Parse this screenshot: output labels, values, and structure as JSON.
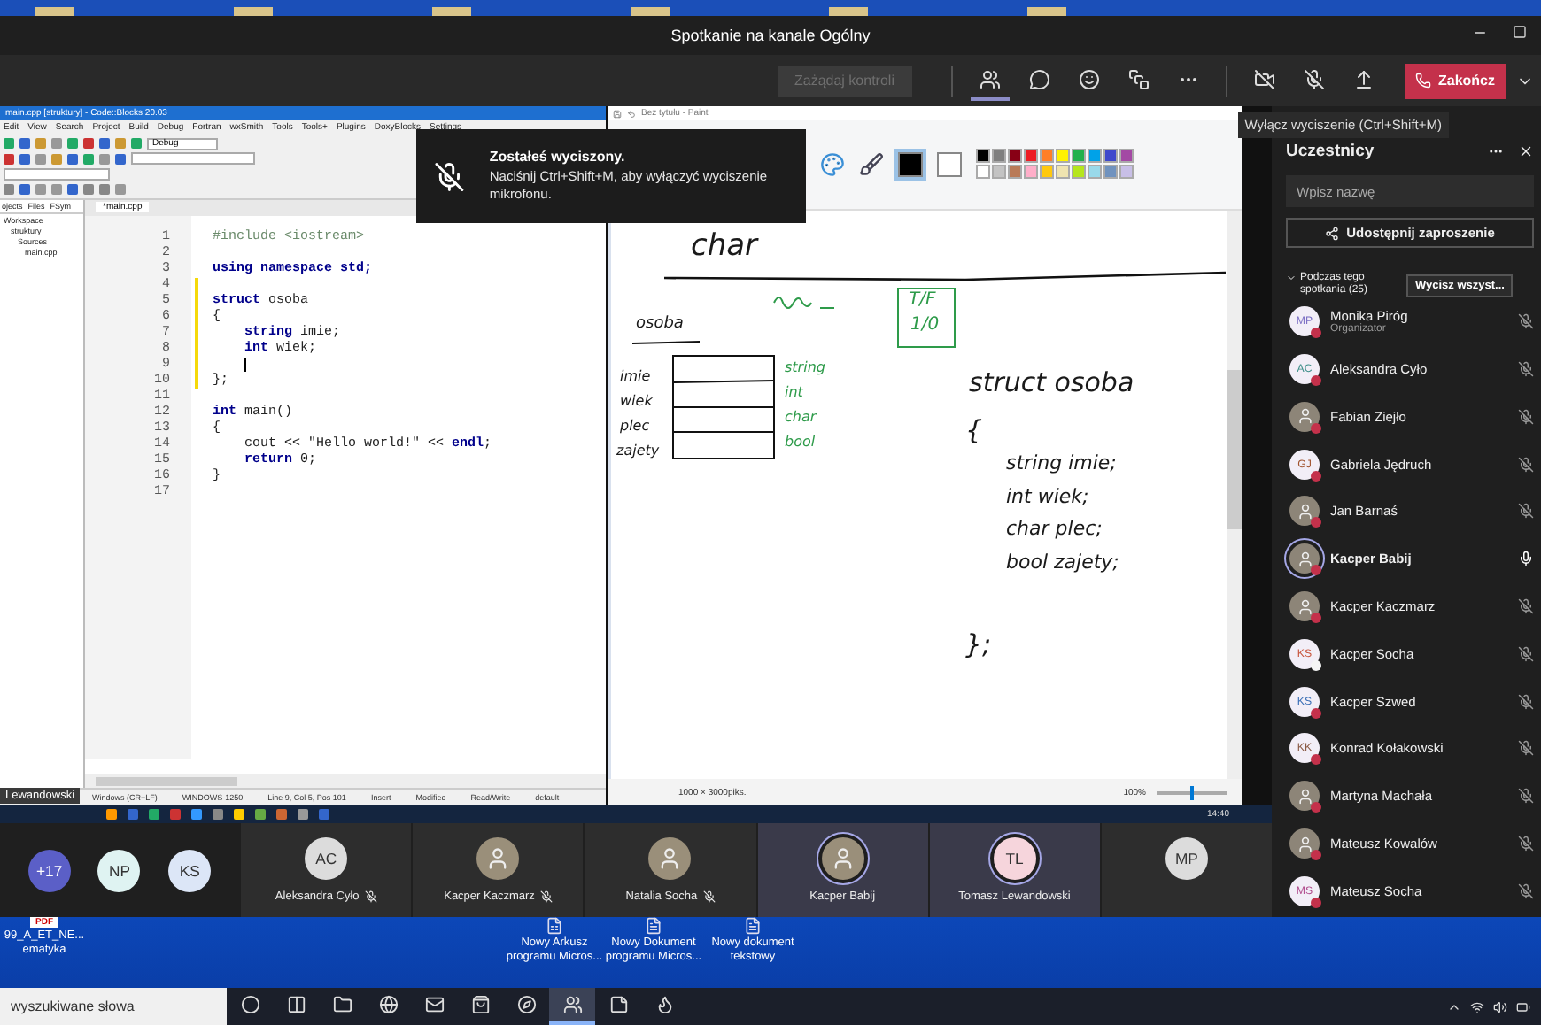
{
  "window": {
    "title": "Spotkanie na kanale Ogólny"
  },
  "toolbar": {
    "request_control": {
      "label": "Zażądaj kontroli",
      "disabled": true
    },
    "tools": [
      {
        "kind": "people",
        "selected": true
      },
      {
        "kind": "chat",
        "selected": false
      },
      {
        "kind": "reactions",
        "selected": false
      },
      {
        "kind": "rooms",
        "selected": false
      },
      {
        "kind": "more",
        "selected": false
      }
    ],
    "media": [
      {
        "kind": "camera",
        "on": false
      },
      {
        "kind": "mic",
        "on": false
      },
      {
        "kind": "share"
      }
    ],
    "end_call": {
      "label": "Zakończ"
    }
  },
  "tooltip": "Wyłącz wyciszenie (Ctrl+Shift+M)",
  "toast": {
    "title": "Zostałeś wyciszony.",
    "message": "Naciśnij Ctrl+Shift+M, aby wyłączyć wyciszenie mikrofonu."
  },
  "shared_screen": {
    "presenter": "Lewandowski",
    "codeblocks": {
      "title": "main.cpp [struktury] - Code::Blocks 20.03",
      "menu": [
        "Edit",
        "View",
        "Search",
        "Project",
        "Build",
        "Debug",
        "Fortran",
        "wxSmith",
        "Tools",
        "Tools+",
        "Plugins",
        "DoxyBlocks",
        "Settings"
      ],
      "build_target": "Debug",
      "panel_tabs": [
        "ojects",
        "Files",
        "FSym"
      ],
      "tree": [
        {
          "label": "Workspace",
          "children": [
            {
              "label": "struktury",
              "children": [
                {
                  "label": "Sources",
                  "children": [
                    {
                      "label": "main.cpp"
                    }
                  ]
                }
              ]
            }
          ]
        }
      ],
      "file_tab": "*main.cpp",
      "lines": [
        {
          "number": "1",
          "kind": "preprocessor",
          "text": "#include <iostream>"
        },
        {
          "number": "2"
        },
        {
          "number": "3",
          "kind": "code",
          "text": "**using namespace std;**"
        },
        {
          "number": "4",
          "changed": true
        },
        {
          "number": "5",
          "kind": "code",
          "text": "**struct** osoba",
          "changed": true
        },
        {
          "number": "6",
          "kind": "code",
          "text": "{",
          "changed": true
        },
        {
          "number": "7",
          "kind": "code",
          "text": "    **string** imie;",
          "changed": true
        },
        {
          "number": "8",
          "kind": "code",
          "text": "    **int** wiek;",
          "changed": true
        },
        {
          "number": "9",
          "changed": true,
          "cursor": true
        },
        {
          "number": "10",
          "kind": "code",
          "text": "};",
          "changed": true
        },
        {
          "number": "11"
        },
        {
          "number": "12",
          "kind": "code",
          "text": "**int** main()"
        },
        {
          "number": "13",
          "kind": "code",
          "text": "{"
        },
        {
          "number": "14",
          "kind": "code",
          "text": "    cout << \"Hello world!\" << **endl**;"
        },
        {
          "number": "15",
          "kind": "code",
          "text": "    **return** 0;"
        },
        {
          "number": "16",
          "kind": "code",
          "text": "}"
        },
        {
          "number": "17"
        }
      ],
      "status": [
        "Windows (CR+LF)",
        "WINDOWS-1250",
        "Line 9, Col 5, Pos 101",
        "Insert",
        "Modified",
        "Read/Write",
        "default"
      ]
    },
    "paint": {
      "title": "Bez tytułu - Paint",
      "color1": {
        "color": "#000000"
      },
      "color2": {
        "color": "#ffffff"
      },
      "palette": [
        {
          "color": "#000000"
        },
        {
          "color": "#7f7f7f"
        },
        {
          "color": "#880015"
        },
        {
          "color": "#ed1c24"
        },
        {
          "color": "#ff7f27"
        },
        {
          "color": "#fff200"
        },
        {
          "color": "#22b14c"
        },
        {
          "color": "#00a2e8"
        },
        {
          "color": "#3f48cc"
        },
        {
          "color": "#a349a4"
        },
        {
          "color": "#ffffff"
        },
        {
          "color": "#c3c3c3"
        },
        {
          "color": "#b97a57"
        },
        {
          "color": "#ffaec9"
        },
        {
          "color": "#ffc90e"
        },
        {
          "color": "#efe4b0"
        },
        {
          "color": "#b5e61d"
        },
        {
          "color": "#99d9ea"
        },
        {
          "color": "#7092be"
        },
        {
          "color": "#c8bfe7"
        }
      ],
      "notes": [
        {
          "text": "char",
          "color": "#1a1a1a"
        },
        {
          "text": "osoba",
          "color": "#1a1a1a"
        },
        {
          "text": "T/F",
          "color": "#2e9b4a"
        },
        {
          "text": "1/0",
          "color": "#2e9b4a"
        },
        {
          "text": "imie",
          "color": "#1a1a1a"
        },
        {
          "text": "wiek",
          "color": "#1a1a1a"
        },
        {
          "text": "plec",
          "color": "#1a1a1a"
        },
        {
          "text": "zajety",
          "color": "#1a1a1a"
        },
        {
          "text": "string",
          "color": "#2e9b4a"
        },
        {
          "text": "int",
          "color": "#2e9b4a"
        },
        {
          "text": "char",
          "color": "#2e9b4a"
        },
        {
          "text": "bool",
          "color": "#2e9b4a"
        },
        {
          "text": "struct osoba",
          "color": "#1a1a1a"
        },
        {
          "text": "{",
          "color": "#1a1a1a"
        },
        {
          "text": "string imie;",
          "color": "#1a1a1a"
        },
        {
          "text": "int wiek;",
          "color": "#1a1a1a"
        },
        {
          "text": "char plec;",
          "color": "#1a1a1a"
        },
        {
          "text": "bool zajety;",
          "color": "#1a1a1a"
        },
        {
          "text": "};",
          "color": "#1a1a1a"
        }
      ],
      "canvas_size": "1000 × 3000piks.",
      "zoom": "100%",
      "zoom_level": {
        "level": 0.5
      }
    },
    "remote_clock": "14:40"
  },
  "video_strip": {
    "overflow": [
      {
        "label": "+17",
        "color": "#5b5fc7"
      },
      {
        "label": "NP",
        "color": "#dff3f2"
      },
      {
        "label": "KS",
        "color": "#dce6f7"
      }
    ],
    "tiles": [
      {
        "kind": "initials",
        "initials": "AC",
        "name": "Aleksandra Cyło",
        "muted": true,
        "speaking": false
      },
      {
        "kind": "photo",
        "name": "Kacper Kaczmarz",
        "muted": true,
        "speaking": false
      },
      {
        "kind": "photo",
        "name": "Natalia Socha",
        "muted": true,
        "speaking": false
      },
      {
        "kind": "photo",
        "name": "Kacper Babij",
        "muted": false,
        "speaking": true
      },
      {
        "kind": "initials",
        "initials": "TL",
        "name": "Tomasz Lewandowski",
        "muted": false,
        "speaking": true
      },
      {
        "kind": "initials",
        "initials": "MP",
        "muted": false,
        "speaking": false
      }
    ]
  },
  "participants": {
    "title": "Uczestnicy",
    "search_placeholder": "Wpisz nazwę",
    "invite": "Udostępnij zaproszenie",
    "section": {
      "label": "Podczas tego spotkania (25)",
      "expanded": true,
      "mute_all": "Wycisz wszyst..."
    },
    "people": [
      {
        "kind": "initials",
        "initials": "MP",
        "color": "#7b6fc4",
        "name": "Monika Piróg",
        "role": "Organizator",
        "presence": {
          "color": "#c4314b"
        },
        "muted": true,
        "self": false
      },
      {
        "kind": "initials",
        "initials": "AC",
        "color": "#3f8f8a",
        "name": "Aleksandra Cyło",
        "presence": {
          "color": "#c4314b"
        },
        "muted": true,
        "self": false
      },
      {
        "kind": "photo",
        "name": "Fabian Ziejło",
        "presence": {
          "color": "#c4314b"
        },
        "muted": true,
        "self": false
      },
      {
        "kind": "initials",
        "initials": "GJ",
        "color": "#a0522d",
        "name": "Gabriela Jędruch",
        "presence": {
          "color": "#c4314b"
        },
        "muted": true,
        "self": false
      },
      {
        "kind": "photo",
        "name": "Jan Barnaś",
        "presence": {
          "color": "#c4314b"
        },
        "muted": true,
        "self": false
      },
      {
        "kind": "photo",
        "name": "Kacper Babij",
        "presence": {
          "color": "#c4314b"
        },
        "muted": false,
        "self": true
      },
      {
        "kind": "photo",
        "name": "Kacper Kaczmarz",
        "presence": {
          "color": "#c4314b"
        },
        "muted": true,
        "self": false
      },
      {
        "kind": "initials",
        "initials": "KS",
        "color": "#c8553d",
        "name": "Kacper Socha",
        "presence": {
          "color": "#f5f5f5"
        },
        "muted": true,
        "self": false
      },
      {
        "kind": "initials",
        "initials": "KS",
        "color": "#3b6fb6",
        "name": "Kacper Szwed",
        "presence": {
          "color": "#c4314b"
        },
        "muted": true,
        "self": false
      },
      {
        "kind": "initials",
        "initials": "KK",
        "color": "#8a5a44",
        "name": "Konrad Kołakowski",
        "presence": {
          "color": "#c4314b"
        },
        "muted": true,
        "self": false
      },
      {
        "kind": "photo",
        "name": "Martyna Machała",
        "presence": {
          "color": "#c4314b"
        },
        "muted": true,
        "self": false
      },
      {
        "kind": "photo",
        "name": "Mateusz Kowalów",
        "presence": {
          "color": "#c4314b"
        },
        "muted": true,
        "self": false
      },
      {
        "kind": "initials",
        "initials": "MS",
        "color": "#b04a8c",
        "name": "Mateusz Socha",
        "presence": {
          "color": "#c4314b"
        },
        "muted": true,
        "self": false
      }
    ]
  },
  "desktop": {
    "icons": [
      {
        "kind": "pdf",
        "badge": "PDF",
        "lines": [
          "99_A_ET_NE...",
          "ematyka"
        ]
      },
      {
        "kind": "sheet",
        "lines": [
          "Nowy Arkusz",
          "programu Micros..."
        ]
      },
      {
        "kind": "doc",
        "lines": [
          "Nowy Dokument",
          "programu Micros..."
        ]
      },
      {
        "kind": "text",
        "lines": [
          "Nowy dokument",
          "tekstowy"
        ]
      }
    ]
  },
  "taskbar": {
    "search_placeholder": "wyszukiwane słowa",
    "apps": [
      {
        "kind": "cortana",
        "active": false
      },
      {
        "kind": "taskview",
        "active": false
      },
      {
        "kind": "explorer",
        "active": false
      },
      {
        "kind": "edge",
        "active": false
      },
      {
        "kind": "mail",
        "active": false
      },
      {
        "kind": "store",
        "active": false
      },
      {
        "kind": "browser",
        "active": false
      },
      {
        "kind": "teams",
        "active": true
      },
      {
        "kind": "notes",
        "active": false
      },
      {
        "kind": "firefox",
        "active": false
      }
    ]
  }
}
